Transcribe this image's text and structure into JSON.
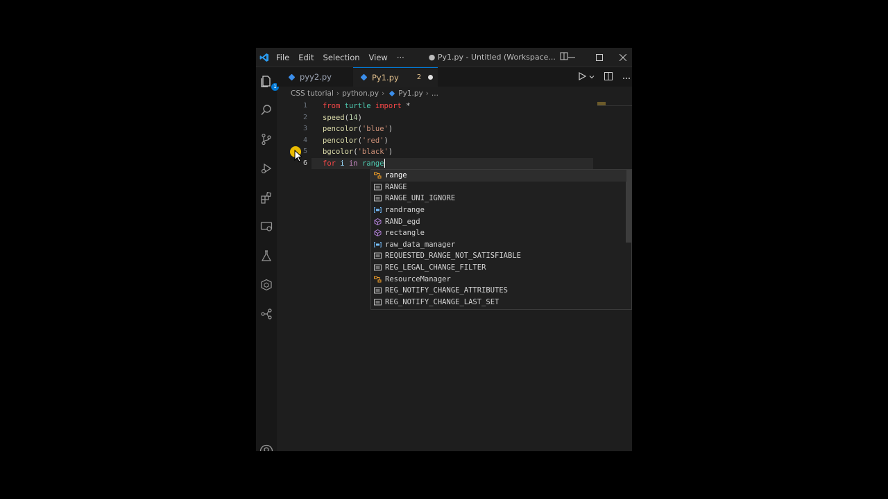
{
  "titlebar": {
    "menus": [
      "File",
      "Edit",
      "Selection",
      "View",
      "···"
    ],
    "title": "● Py1.py - Untitled (Workspace..."
  },
  "tabs": [
    {
      "label": "pyy2.py"
    },
    {
      "label": "Py1.py",
      "problems": "2"
    }
  ],
  "breadcrumb": [
    "CSS tutorial",
    "python.py",
    "Py1.py",
    "..."
  ],
  "editor": {
    "line_numbers": [
      "1",
      "2",
      "3",
      "4",
      "5",
      "6"
    ],
    "lines": [
      [
        {
          "t": "from",
          "c": "kw2"
        },
        {
          "t": " ",
          "c": "op"
        },
        {
          "t": "turtle",
          "c": "mod"
        },
        {
          "t": " ",
          "c": "op"
        },
        {
          "t": "import",
          "c": "kw2"
        },
        {
          "t": " *",
          "c": "op"
        }
      ],
      [
        {
          "t": "speed",
          "c": "fn"
        },
        {
          "t": "(",
          "c": "op"
        },
        {
          "t": "14",
          "c": "num"
        },
        {
          "t": ")",
          "c": "op"
        }
      ],
      [
        {
          "t": "pencolor",
          "c": "fn"
        },
        {
          "t": "(",
          "c": "op"
        },
        {
          "t": "'blue'",
          "c": "str"
        },
        {
          "t": ")",
          "c": "op"
        }
      ],
      [
        {
          "t": "pencolor",
          "c": "fn"
        },
        {
          "t": "(",
          "c": "op"
        },
        {
          "t": "'red'",
          "c": "str"
        },
        {
          "t": ")",
          "c": "op"
        }
      ],
      [
        {
          "t": "bgcolor",
          "c": "fn"
        },
        {
          "t": "(",
          "c": "op"
        },
        {
          "t": "'black'",
          "c": "str"
        },
        {
          "t": ")",
          "c": "op"
        }
      ],
      [
        {
          "t": "for",
          "c": "kw2"
        },
        {
          "t": " ",
          "c": "op"
        },
        {
          "t": "i",
          "c": "var"
        },
        {
          "t": " ",
          "c": "op"
        },
        {
          "t": "in",
          "c": "kw"
        },
        {
          "t": " ",
          "c": "op"
        },
        {
          "t": "range",
          "c": "mod"
        }
      ]
    ]
  },
  "suggestions": [
    {
      "label": "range",
      "icon": "class-icon"
    },
    {
      "label": "RANGE",
      "icon": "constant-icon"
    },
    {
      "label": "RANGE_UNI_IGNORE",
      "icon": "constant-icon"
    },
    {
      "label": "randrange",
      "icon": "variable-icon"
    },
    {
      "label": "RAND_egd",
      "icon": "method-icon"
    },
    {
      "label": "rectangle",
      "icon": "method-icon"
    },
    {
      "label": "raw_data_manager",
      "icon": "variable-icon"
    },
    {
      "label": "REQUESTED_RANGE_NOT_SATISFIABLE",
      "icon": "constant-icon"
    },
    {
      "label": "REG_LEGAL_CHANGE_FILTER",
      "icon": "constant-icon"
    },
    {
      "label": "ResourceManager",
      "icon": "class-icon"
    },
    {
      "label": "REG_NOTIFY_CHANGE_ATTRIBUTES",
      "icon": "constant-icon"
    },
    {
      "label": "REG_NOTIFY_CHANGE_LAST_SET",
      "icon": "constant-icon"
    }
  ],
  "activity_badge": "1",
  "colors": {
    "accent": "#0078d4",
    "background": "#1e1e1e",
    "modified_tab": "#e2c08d"
  }
}
